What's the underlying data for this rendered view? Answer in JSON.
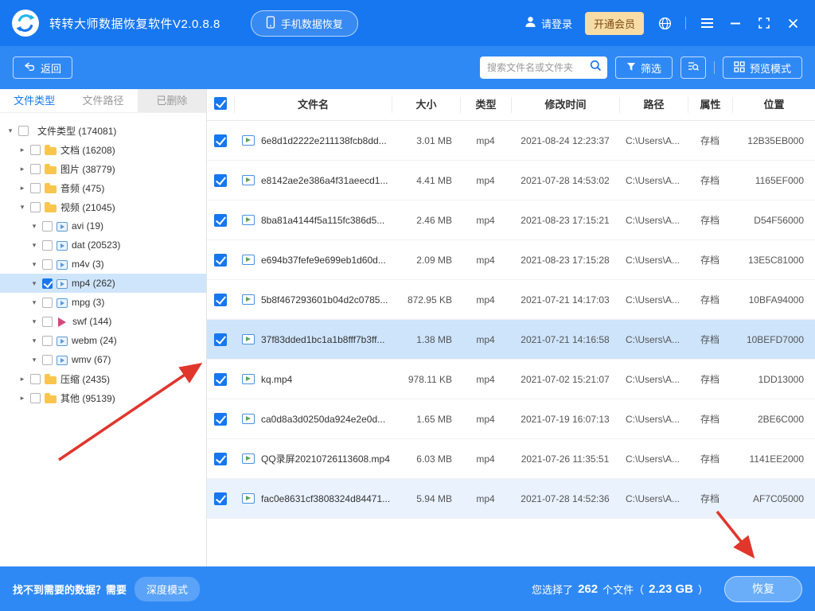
{
  "colors": {
    "topbar_blue": "#1777f0",
    "toolbar_blue": "#2f89f5",
    "accent_blue": "#1777f0",
    "selected_row": "#cde4fb",
    "sidebar_selected": "#cfe5fb",
    "vip_bg": "#f8dca6",
    "vip_text": "#7a4a12",
    "annotation_red": "#e0362c"
  },
  "titlebar": {
    "app_title": "转转大师数据恢复软件V2.0.8.8",
    "phone_recovery_label": "手机数据恢复",
    "login_label": "请登录",
    "vip_label": "开通会员"
  },
  "toolbar": {
    "back_label": "返回",
    "search_placeholder": "搜索文件名或文件夹",
    "filter_label": "筛选",
    "preview_label": "预览模式"
  },
  "sidebar": {
    "tabs": [
      {
        "label": "文件类型",
        "active": true
      },
      {
        "label": "文件路径",
        "active": false
      },
      {
        "label": "已删除",
        "active": false
      }
    ],
    "tree": [
      {
        "label": "文件类型 (174081)",
        "level": 0,
        "expander": "down",
        "checked": false,
        "icon": "none",
        "selected": false
      },
      {
        "label": "文档 (16208)",
        "level": 1,
        "expander": "right",
        "checked": false,
        "icon": "folder",
        "selected": false
      },
      {
        "label": "图片 (38779)",
        "level": 1,
        "expander": "right",
        "checked": false,
        "icon": "folder",
        "selected": false
      },
      {
        "label": "音频 (475)",
        "level": 1,
        "expander": "right",
        "checked": false,
        "icon": "folder",
        "selected": false
      },
      {
        "label": "视频 (21045)",
        "level": 1,
        "expander": "down",
        "checked": false,
        "icon": "folder",
        "selected": false
      },
      {
        "label": "avi (19)",
        "level": 2,
        "expander": "down",
        "checked": false,
        "icon": "film",
        "selected": false
      },
      {
        "label": "dat (20523)",
        "level": 2,
        "expander": "down",
        "checked": false,
        "icon": "film",
        "selected": false
      },
      {
        "label": "m4v (3)",
        "level": 2,
        "expander": "down",
        "checked": false,
        "icon": "film",
        "selected": false
      },
      {
        "label": "mp4 (262)",
        "level": 2,
        "expander": "down",
        "checked": true,
        "icon": "film",
        "selected": true
      },
      {
        "label": "mpg (3)",
        "level": 2,
        "expander": "down",
        "checked": false,
        "icon": "film",
        "selected": false
      },
      {
        "label": "swf (144)",
        "level": 2,
        "expander": "down",
        "checked": false,
        "icon": "play",
        "selected": false
      },
      {
        "label": "webm (24)",
        "level": 2,
        "expander": "down",
        "checked": false,
        "icon": "film",
        "selected": false
      },
      {
        "label": "wmv (67)",
        "level": 2,
        "expander": "down",
        "checked": false,
        "icon": "film",
        "selected": false
      },
      {
        "label": "压缩 (2435)",
        "level": 1,
        "expander": "right",
        "checked": false,
        "icon": "folder",
        "selected": false
      },
      {
        "label": "其他 (95139)",
        "level": 1,
        "expander": "right",
        "checked": false,
        "icon": "folder",
        "selected": false
      }
    ]
  },
  "table": {
    "headers": [
      "文件名",
      "大小",
      "类型",
      "修改时间",
      "路径",
      "属性",
      "位置"
    ],
    "rows": [
      {
        "name": "6e8d1d2222e211138fcb8dd...",
        "size": "3.01 MB",
        "type": "mp4",
        "mtime": "2021-08-24 12:23:37",
        "path": "C:\\Users\\A...",
        "attr": "存档",
        "loc": "12B35EB000",
        "checked": true,
        "state": ""
      },
      {
        "name": "e8142ae2e386a4f31aeecd1...",
        "size": "4.41 MB",
        "type": "mp4",
        "mtime": "2021-07-28 14:53:02",
        "path": "C:\\Users\\A...",
        "attr": "存档",
        "loc": "1165EF000",
        "checked": true,
        "state": ""
      },
      {
        "name": "8ba81a4144f5a115fc386d5...",
        "size": "2.46 MB",
        "type": "mp4",
        "mtime": "2021-08-23 17:15:21",
        "path": "C:\\Users\\A...",
        "attr": "存档",
        "loc": "D54F56000",
        "checked": true,
        "state": ""
      },
      {
        "name": "e694b37fefe9e699eb1d60d...",
        "size": "2.09 MB",
        "type": "mp4",
        "mtime": "2021-08-23 17:15:28",
        "path": "C:\\Users\\A...",
        "attr": "存档",
        "loc": "13E5C81000",
        "checked": true,
        "state": ""
      },
      {
        "name": "5b8f467293601b04d2c0785...",
        "size": "872.95 KB",
        "type": "mp4",
        "mtime": "2021-07-21 14:17:03",
        "path": "C:\\Users\\A...",
        "attr": "存档",
        "loc": "10BFA94000",
        "checked": true,
        "state": ""
      },
      {
        "name": "37f83dded1bc1a1b8fff7b3ff...",
        "size": "1.38 MB",
        "type": "mp4",
        "mtime": "2021-07-21 14:16:58",
        "path": "C:\\Users\\A...",
        "attr": "存档",
        "loc": "10BEFD7000",
        "checked": true,
        "state": "selected"
      },
      {
        "name": "kq.mp4",
        "size": "978.11 KB",
        "type": "mp4",
        "mtime": "2021-07-02 15:21:07",
        "path": "C:\\Users\\A...",
        "attr": "存档",
        "loc": "1DD13000",
        "checked": true,
        "state": ""
      },
      {
        "name": "ca0d8a3d0250da924e2e0d...",
        "size": "1.65 MB",
        "type": "mp4",
        "mtime": "2021-07-19 16:07:13",
        "path": "C:\\Users\\A...",
        "attr": "存档",
        "loc": "2BE6C000",
        "checked": true,
        "state": ""
      },
      {
        "name": "QQ录屏20210726113608.mp4",
        "size": "6.03 MB",
        "type": "mp4",
        "mtime": "2021-07-26 11:35:51",
        "path": "C:\\Users\\A...",
        "attr": "存档",
        "loc": "1141EE2000",
        "checked": true,
        "state": ""
      },
      {
        "name": "fac0e8631cf3808324d84471...",
        "size": "5.94 MB",
        "type": "mp4",
        "mtime": "2021-07-28 14:52:36",
        "path": "C:\\Users\\A...",
        "attr": "存档",
        "loc": "AF7C05000",
        "checked": true,
        "state": "hover"
      }
    ]
  },
  "footer": {
    "hint_text": "找不到需要的数据？需要",
    "deep_mode_label": "深度模式",
    "selection_prefix": "您选择了",
    "selected_count": "262",
    "selection_unit": "个文件（",
    "selected_size": "2.23 GB",
    "selection_suffix": "）",
    "recover_label": "恢复"
  }
}
